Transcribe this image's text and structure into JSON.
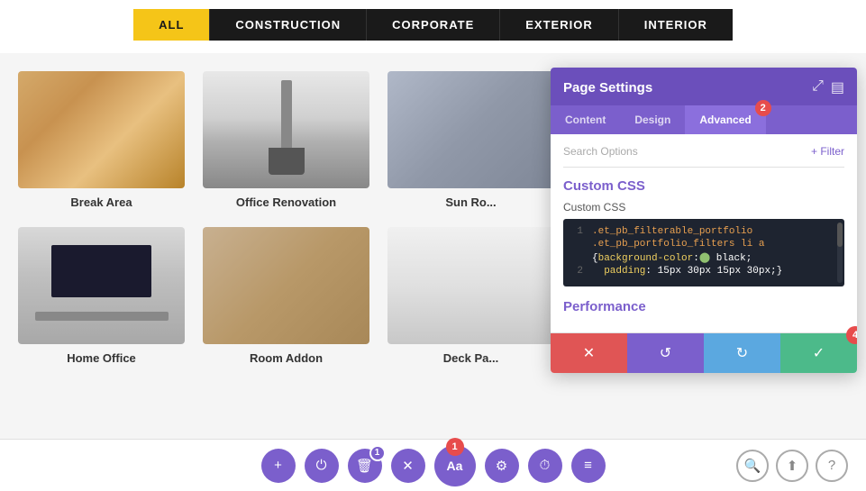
{
  "filter_tabs": [
    {
      "id": "all",
      "label": "ALL",
      "active": true
    },
    {
      "id": "construction",
      "label": "CONSTRUCTION",
      "active": false
    },
    {
      "id": "corporate",
      "label": "CORPORATE",
      "active": false
    },
    {
      "id": "exterior",
      "label": "EXTERIOR",
      "active": false
    },
    {
      "id": "interior",
      "label": "INTERIOR",
      "active": false
    }
  ],
  "portfolio_items": [
    {
      "id": 1,
      "label": "Break Area",
      "thumb_class": "portfolio-thumb-wood-light"
    },
    {
      "id": 2,
      "label": "Office Renovation",
      "thumb_class": "portfolio-thumb-brush"
    },
    {
      "id": 3,
      "label": "Sun Ro...",
      "thumb_class": "portfolio-thumb-sunroof"
    },
    {
      "id": 4,
      "label": "Home Office",
      "thumb_class": "portfolio-thumb-office"
    },
    {
      "id": 5,
      "label": "Room Addon",
      "thumb_class": "portfolio-thumb-room"
    },
    {
      "id": 6,
      "label": "Deck Pa...",
      "thumb_class": "portfolio-thumb-deck"
    }
  ],
  "panel": {
    "title": "Page Settings",
    "tabs": [
      {
        "label": "Content",
        "active": false
      },
      {
        "label": "Design",
        "active": false
      },
      {
        "label": "Advanced",
        "active": true,
        "badge": "2"
      }
    ],
    "search_placeholder": "Search Options",
    "filter_label": "+ Filter",
    "custom_css_section": "Custom CSS",
    "custom_css_label": "Custom CSS",
    "code_lines": [
      {
        "num": "1",
        "text": ".et_pb_filterable_portfolio"
      },
      {
        "num": "",
        "text": ".et_pb_portfolio_filters li a"
      },
      {
        "num": "",
        "text": "{background-color: black;"
      },
      {
        "num": "2",
        "text": "  padding: 15px 30px 15px 30px;}"
      }
    ],
    "performance_section": "Performance",
    "footer_buttons": [
      {
        "id": "cancel",
        "icon": "✕",
        "class": "cancel"
      },
      {
        "id": "undo",
        "icon": "↺",
        "class": "undo"
      },
      {
        "id": "redo",
        "icon": "↻",
        "class": "redo"
      },
      {
        "id": "save",
        "icon": "✓",
        "class": "save",
        "badge": "4"
      }
    ]
  },
  "toolbar": {
    "buttons": [
      {
        "id": "add",
        "icon": "+",
        "title": "Add"
      },
      {
        "id": "power",
        "icon": "⏻",
        "title": "Power"
      },
      {
        "id": "trash",
        "icon": "🗑",
        "title": "Delete",
        "badge": "1"
      },
      {
        "id": "close",
        "icon": "✕",
        "title": "Close"
      },
      {
        "id": "text",
        "icon": "Aa",
        "title": "Text",
        "step": "1"
      },
      {
        "id": "settings",
        "icon": "⚙",
        "title": "Settings"
      },
      {
        "id": "history",
        "icon": "⏱",
        "title": "History"
      },
      {
        "id": "layers",
        "icon": "≡",
        "title": "Layers"
      }
    ],
    "right_buttons": [
      {
        "id": "search",
        "icon": "🔍"
      },
      {
        "id": "portability",
        "icon": "⬆"
      },
      {
        "id": "help",
        "icon": "?"
      }
    ]
  }
}
